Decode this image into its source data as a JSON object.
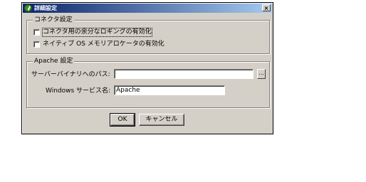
{
  "window": {
    "title": "詳細設定",
    "close_label": "×"
  },
  "connector_group": {
    "legend": "コネクタ設定",
    "options": [
      {
        "label": "コネクタ用の余分なロギングの有効化",
        "checked": false
      },
      {
        "label": "ネイティブ OS メモリアロケータの有効化",
        "checked": false
      }
    ]
  },
  "apache_group": {
    "legend": "Apache 設定",
    "binary_path_label": "サーバーバイナリへのパス:",
    "binary_path_value": "",
    "browse_label": "...",
    "service_name_label": "Windows サービス名:",
    "service_name_value": "Apache"
  },
  "buttons": {
    "ok_label": "OK",
    "cancel_label": "キャンセル"
  },
  "colors": {
    "titlebar_start": "#0a246a",
    "titlebar_end": "#a6caf0",
    "dialog_bg": "#d4d0c8"
  }
}
